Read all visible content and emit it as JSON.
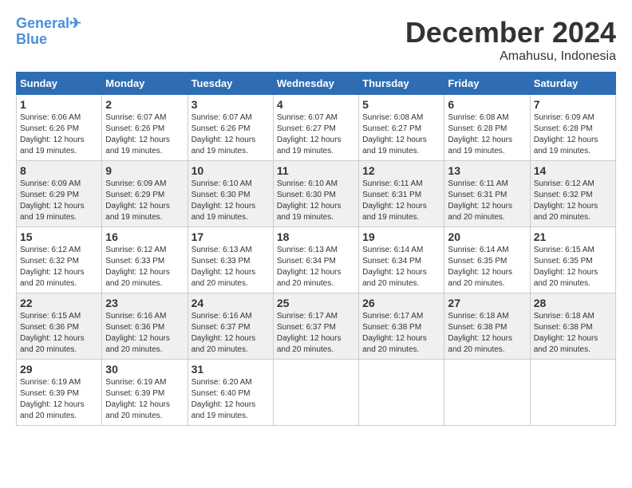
{
  "logo": {
    "line1": "General",
    "line2": "Blue"
  },
  "title": "December 2024",
  "location": "Amahusu, Indonesia",
  "days_of_week": [
    "Sunday",
    "Monday",
    "Tuesday",
    "Wednesday",
    "Thursday",
    "Friday",
    "Saturday"
  ],
  "weeks": [
    [
      {
        "day": "1",
        "sunrise": "6:06 AM",
        "sunset": "6:26 PM",
        "daylight": "12 hours and 19 minutes."
      },
      {
        "day": "2",
        "sunrise": "6:07 AM",
        "sunset": "6:26 PM",
        "daylight": "12 hours and 19 minutes."
      },
      {
        "day": "3",
        "sunrise": "6:07 AM",
        "sunset": "6:26 PM",
        "daylight": "12 hours and 19 minutes."
      },
      {
        "day": "4",
        "sunrise": "6:07 AM",
        "sunset": "6:27 PM",
        "daylight": "12 hours and 19 minutes."
      },
      {
        "day": "5",
        "sunrise": "6:08 AM",
        "sunset": "6:27 PM",
        "daylight": "12 hours and 19 minutes."
      },
      {
        "day": "6",
        "sunrise": "6:08 AM",
        "sunset": "6:28 PM",
        "daylight": "12 hours and 19 minutes."
      },
      {
        "day": "7",
        "sunrise": "6:09 AM",
        "sunset": "6:28 PM",
        "daylight": "12 hours and 19 minutes."
      }
    ],
    [
      {
        "day": "8",
        "sunrise": "6:09 AM",
        "sunset": "6:29 PM",
        "daylight": "12 hours and 19 minutes."
      },
      {
        "day": "9",
        "sunrise": "6:09 AM",
        "sunset": "6:29 PM",
        "daylight": "12 hours and 19 minutes."
      },
      {
        "day": "10",
        "sunrise": "6:10 AM",
        "sunset": "6:30 PM",
        "daylight": "12 hours and 19 minutes."
      },
      {
        "day": "11",
        "sunrise": "6:10 AM",
        "sunset": "6:30 PM",
        "daylight": "12 hours and 19 minutes."
      },
      {
        "day": "12",
        "sunrise": "6:11 AM",
        "sunset": "6:31 PM",
        "daylight": "12 hours and 19 minutes."
      },
      {
        "day": "13",
        "sunrise": "6:11 AM",
        "sunset": "6:31 PM",
        "daylight": "12 hours and 20 minutes."
      },
      {
        "day": "14",
        "sunrise": "6:12 AM",
        "sunset": "6:32 PM",
        "daylight": "12 hours and 20 minutes."
      }
    ],
    [
      {
        "day": "15",
        "sunrise": "6:12 AM",
        "sunset": "6:32 PM",
        "daylight": "12 hours and 20 minutes."
      },
      {
        "day": "16",
        "sunrise": "6:12 AM",
        "sunset": "6:33 PM",
        "daylight": "12 hours and 20 minutes."
      },
      {
        "day": "17",
        "sunrise": "6:13 AM",
        "sunset": "6:33 PM",
        "daylight": "12 hours and 20 minutes."
      },
      {
        "day": "18",
        "sunrise": "6:13 AM",
        "sunset": "6:34 PM",
        "daylight": "12 hours and 20 minutes."
      },
      {
        "day": "19",
        "sunrise": "6:14 AM",
        "sunset": "6:34 PM",
        "daylight": "12 hours and 20 minutes."
      },
      {
        "day": "20",
        "sunrise": "6:14 AM",
        "sunset": "6:35 PM",
        "daylight": "12 hours and 20 minutes."
      },
      {
        "day": "21",
        "sunrise": "6:15 AM",
        "sunset": "6:35 PM",
        "daylight": "12 hours and 20 minutes."
      }
    ],
    [
      {
        "day": "22",
        "sunrise": "6:15 AM",
        "sunset": "6:36 PM",
        "daylight": "12 hours and 20 minutes."
      },
      {
        "day": "23",
        "sunrise": "6:16 AM",
        "sunset": "6:36 PM",
        "daylight": "12 hours and 20 minutes."
      },
      {
        "day": "24",
        "sunrise": "6:16 AM",
        "sunset": "6:37 PM",
        "daylight": "12 hours and 20 minutes."
      },
      {
        "day": "25",
        "sunrise": "6:17 AM",
        "sunset": "6:37 PM",
        "daylight": "12 hours and 20 minutes."
      },
      {
        "day": "26",
        "sunrise": "6:17 AM",
        "sunset": "6:38 PM",
        "daylight": "12 hours and 20 minutes."
      },
      {
        "day": "27",
        "sunrise": "6:18 AM",
        "sunset": "6:38 PM",
        "daylight": "12 hours and 20 minutes."
      },
      {
        "day": "28",
        "sunrise": "6:18 AM",
        "sunset": "6:38 PM",
        "daylight": "12 hours and 20 minutes."
      }
    ],
    [
      {
        "day": "29",
        "sunrise": "6:19 AM",
        "sunset": "6:39 PM",
        "daylight": "12 hours and 20 minutes."
      },
      {
        "day": "30",
        "sunrise": "6:19 AM",
        "sunset": "6:39 PM",
        "daylight": "12 hours and 20 minutes."
      },
      {
        "day": "31",
        "sunrise": "6:20 AM",
        "sunset": "6:40 PM",
        "daylight": "12 hours and 19 minutes."
      },
      null,
      null,
      null,
      null
    ]
  ],
  "labels": {
    "sunrise": "Sunrise:",
    "sunset": "Sunset:",
    "daylight": "Daylight:"
  }
}
